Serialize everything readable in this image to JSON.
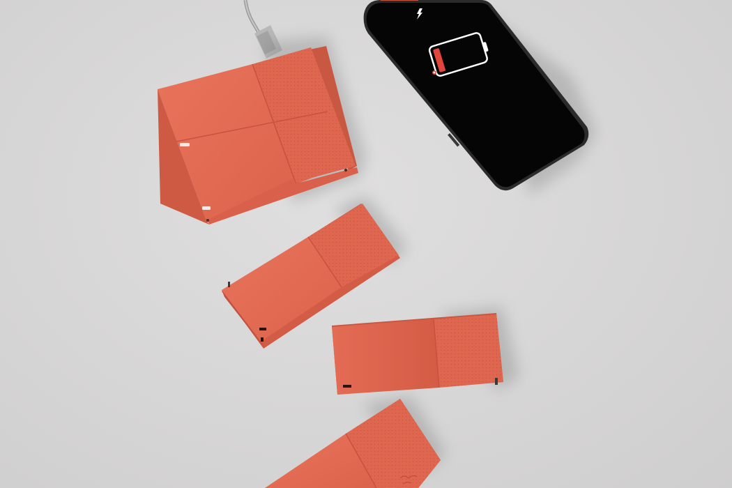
{
  "scene": {
    "background_color": "#d9d8d8",
    "device_color": "#e06a52",
    "device_shade_color": "#c95843",
    "phone_color": "#050505",
    "battery_indicator_color": "#e0463c"
  },
  "objects": {
    "phone": {
      "icon": "lightning-bolt-icon",
      "battery_icon": "low-battery-icon"
    },
    "modules": [
      "power-bank-hub",
      "battery-module-1",
      "battery-module-2",
      "battery-module-3"
    ]
  }
}
